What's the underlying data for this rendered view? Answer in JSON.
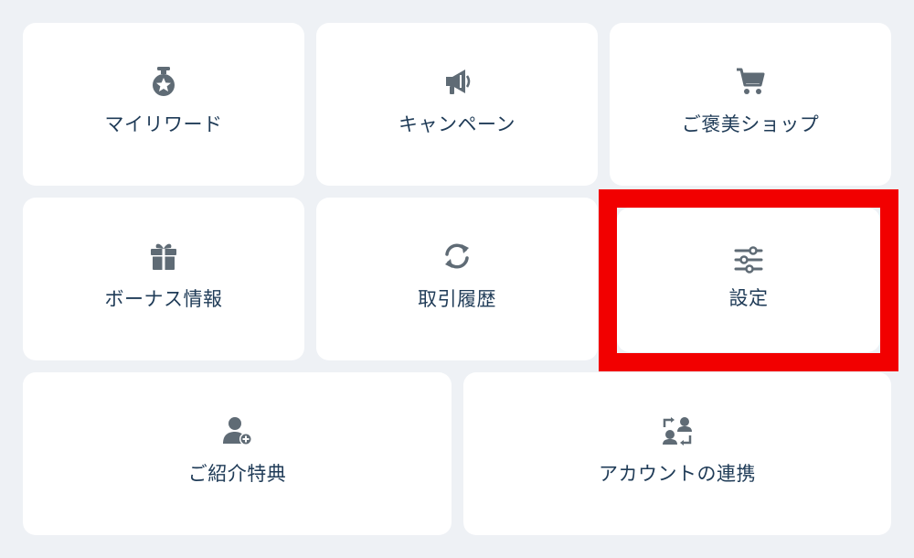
{
  "menu": {
    "items": [
      {
        "label": "マイリワード",
        "icon": "reward-medal-icon"
      },
      {
        "label": "キャンペーン",
        "icon": "megaphone-icon"
      },
      {
        "label": "ご褒美ショップ",
        "icon": "shopping-cart-icon"
      },
      {
        "label": "ボーナス情報",
        "icon": "gift-icon"
      },
      {
        "label": "取引履歴",
        "icon": "refresh-icon"
      },
      {
        "label": "設定",
        "icon": "sliders-icon"
      },
      {
        "label": "ご紹介特典",
        "icon": "add-user-icon"
      },
      {
        "label": "アカウントの連携",
        "icon": "switch-account-icon"
      }
    ],
    "selected": "設定"
  },
  "colors": {
    "background": "#eef1f5",
    "tile": "#ffffff",
    "icon": "#5f6b75",
    "text": "#1f3b57",
    "highlight": "#f20000"
  }
}
